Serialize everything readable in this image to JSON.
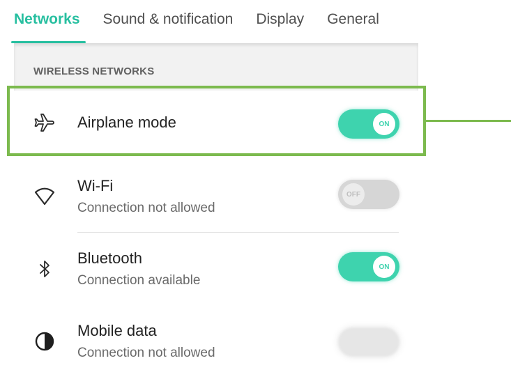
{
  "tabs": [
    {
      "label": "Networks",
      "active": true
    },
    {
      "label": "Sound & notification",
      "active": false
    },
    {
      "label": "Display",
      "active": false
    },
    {
      "label": "General",
      "active": false
    }
  ],
  "section": {
    "label": "WIRELESS NETWORKS"
  },
  "rows": [
    {
      "title": "Airplane mode",
      "subtitle": "",
      "icon": "airplane-icon",
      "toggle": "ON",
      "state": "on"
    },
    {
      "title": "Wi-Fi",
      "subtitle": "Connection not allowed",
      "icon": "wifi-icon",
      "toggle": "OFF",
      "state": "off"
    },
    {
      "title": "Bluetooth",
      "subtitle": "Connection available",
      "icon": "bluetooth-icon",
      "toggle": "ON",
      "state": "on"
    },
    {
      "title": "Mobile data",
      "subtitle": "Connection not allowed",
      "icon": "mobile-data-icon",
      "toggle": "",
      "state": "obscured"
    }
  ],
  "colors": {
    "accent": "#27bfa0",
    "toggle_on": "#3ed3ae",
    "highlight": "#7cba4e"
  }
}
